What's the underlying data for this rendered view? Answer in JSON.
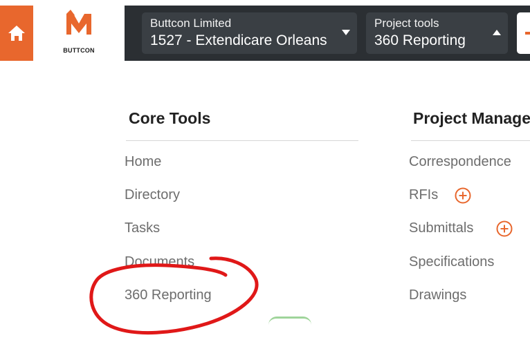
{
  "header": {
    "home_icon": "home-icon",
    "logo_text": "BUTTCON",
    "company_dropdown": {
      "label": "Buttcon Limited",
      "value": "1527 - Extendicare Orleans",
      "icon": "caret-down-icon"
    },
    "tools_dropdown": {
      "label": "Project tools",
      "value": "360 Reporting",
      "icon": "caret-up-icon"
    }
  },
  "core_tools": {
    "title": "Core Tools",
    "items": [
      {
        "label": "Home"
      },
      {
        "label": "Directory"
      },
      {
        "label": "Tasks"
      },
      {
        "label": "Documents"
      },
      {
        "label": "360 Reporting"
      }
    ]
  },
  "project_management": {
    "title": "Project Manage",
    "items": [
      {
        "label": "Correspondence"
      },
      {
        "label": "RFIs",
        "icon": "add-circle-icon"
      },
      {
        "label": "Submittals",
        "icon": "add-circle-icon"
      },
      {
        "label": "Specifications"
      },
      {
        "label": "Drawings"
      }
    ]
  },
  "colors": {
    "accent": "#e8672d",
    "topbar": "#2b2f33",
    "dropdown": "#3a3f44",
    "annotation": "#e01818"
  }
}
